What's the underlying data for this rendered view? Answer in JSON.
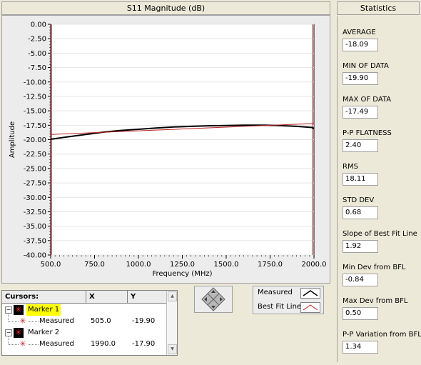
{
  "chart_header": "S11 Magnitude (dB)",
  "stats_header": "Statistics",
  "stats": [
    {
      "label": "AVERAGE",
      "value": "-18.09"
    },
    {
      "label": "MIN OF DATA",
      "value": "-19.90"
    },
    {
      "label": "MAX OF DATA",
      "value": "-17.49"
    },
    {
      "label": "P-P FLATNESS",
      "value": "2.40"
    },
    {
      "label": "RMS",
      "value": "18.11"
    },
    {
      "label": "STD DEV",
      "value": "0.68"
    },
    {
      "label": "Slope of Best Fit Line",
      "value": "1.92"
    },
    {
      "label": "Min Dev from BFL",
      "value": "-0.84"
    },
    {
      "label": "Max Dev from BFL",
      "value": "0.50"
    },
    {
      "label": "P-P Variation from BFL",
      "value": "1.34"
    }
  ],
  "cursors": {
    "header": {
      "name": "Cursors:",
      "x": "X",
      "y": "Y"
    },
    "markers": [
      {
        "name": "Marker 1",
        "expander": "−",
        "child": "Measured",
        "x": "505.0",
        "y": "-19.90"
      },
      {
        "name": "Marker 2",
        "expander": "−",
        "child": "Measured",
        "x": "1990.0",
        "y": "-17.90"
      }
    ]
  },
  "legend": [
    {
      "label": "Measured",
      "color": "#000000"
    },
    {
      "label": "Best Fit Line",
      "color": "#c02020"
    }
  ],
  "chart_data": {
    "type": "line",
    "xlabel": "Frequency (MHz)",
    "ylabel": "Amplitude",
    "xlim": [
      500,
      2000
    ],
    "ylim": [
      -40,
      0
    ],
    "x_ticks": [
      "500.0",
      "750.0",
      "1000.0",
      "1250.0",
      "1500.0",
      "1750.0",
      "2000.0"
    ],
    "y_ticks": [
      "0.00",
      "-2.50",
      "-5.00",
      "-7.50",
      "-10.00",
      "-12.50",
      "-15.00",
      "-17.50",
      "-20.00",
      "-22.50",
      "-25.00",
      "-27.50",
      "-30.00",
      "-32.50",
      "-35.00",
      "-37.50",
      "-40.00"
    ],
    "series": [
      {
        "name": "Measured",
        "color": "#000000",
        "x": [
          500,
          505,
          600,
          700,
          800,
          900,
          1000,
          1100,
          1200,
          1300,
          1400,
          1500,
          1600,
          1700,
          1800,
          1900,
          1990,
          2000
        ],
        "y": [
          -19.9,
          -19.9,
          -19.5,
          -19.1,
          -18.7,
          -18.4,
          -18.2,
          -18.0,
          -17.8,
          -17.7,
          -17.6,
          -17.55,
          -17.5,
          -17.49,
          -17.55,
          -17.7,
          -17.9,
          -18.1
        ]
      },
      {
        "name": "Best Fit Line",
        "color": "#c02020",
        "x": [
          500,
          2000
        ],
        "y": [
          -19.1,
          -17.2
        ]
      }
    ],
    "markers": [
      {
        "name": "Marker 1",
        "x": 505.0,
        "y": -19.9
      },
      {
        "name": "Marker 2",
        "x": 1990.0,
        "y": -17.9
      }
    ]
  }
}
